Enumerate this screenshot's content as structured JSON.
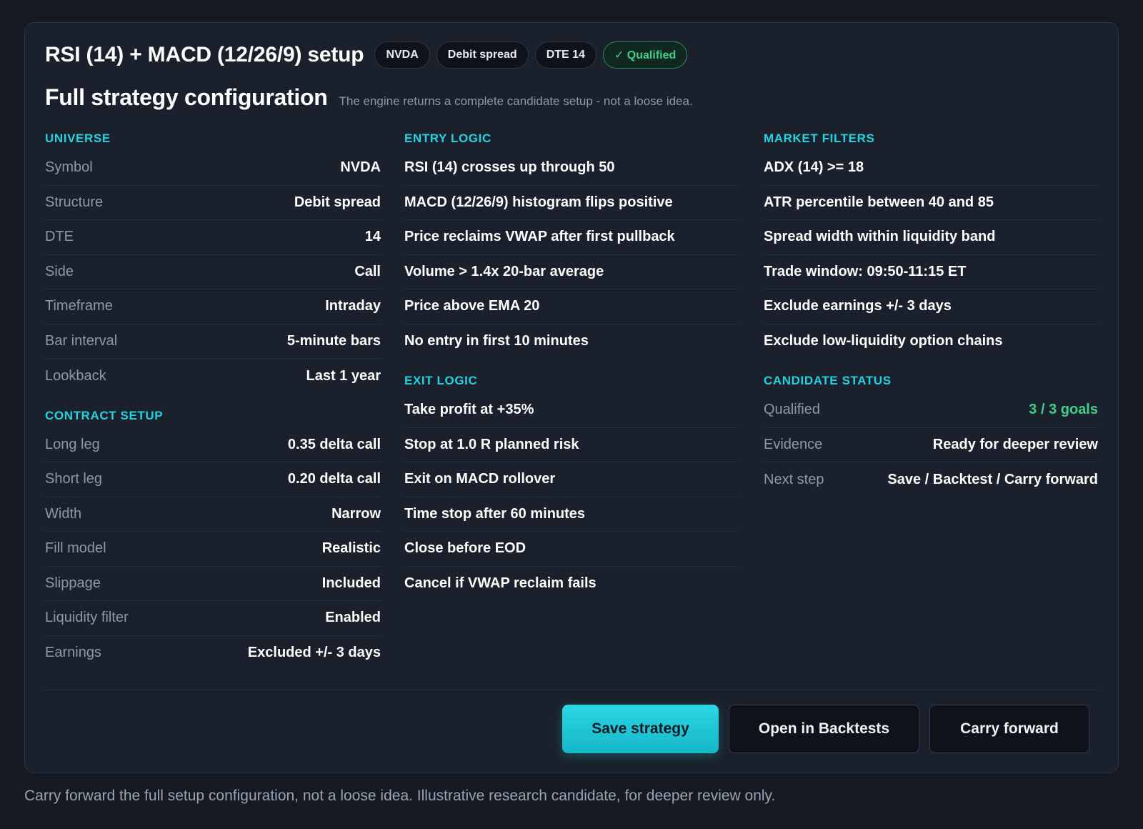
{
  "header": {
    "title": "RSI (14) + MACD (12/26/9) setup",
    "pills": [
      "NVDA",
      "Debit spread",
      "DTE 14"
    ],
    "status_pill": "✓ Qualified"
  },
  "section": {
    "title": "Full strategy configuration",
    "description": "The engine returns a complete candidate setup - not a loose idea."
  },
  "universe": {
    "label": "UNIVERSE",
    "rows": [
      {
        "k": "Symbol",
        "v": "NVDA"
      },
      {
        "k": "Structure",
        "v": "Debit spread"
      },
      {
        "k": "DTE",
        "v": "14"
      },
      {
        "k": "Side",
        "v": "Call"
      },
      {
        "k": "Timeframe",
        "v": "Intraday"
      },
      {
        "k": "Bar interval",
        "v": "5-minute bars"
      },
      {
        "k": "Lookback",
        "v": "Last 1 year"
      }
    ]
  },
  "contract": {
    "label": "CONTRACT SETUP",
    "rows": [
      {
        "k": "Long leg",
        "v": "0.35 delta call"
      },
      {
        "k": "Short leg",
        "v": "0.20 delta call"
      },
      {
        "k": "Width",
        "v": "Narrow"
      },
      {
        "k": "Fill model",
        "v": "Realistic"
      },
      {
        "k": "Slippage",
        "v": "Included"
      },
      {
        "k": "Liquidity filter",
        "v": "Enabled"
      },
      {
        "k": "Earnings",
        "v": "Excluded +/- 3 days"
      }
    ]
  },
  "entry": {
    "label": "ENTRY LOGIC",
    "items": [
      "RSI (14) crosses up through 50",
      "MACD (12/26/9) histogram flips positive",
      "Price reclaims VWAP after first pullback",
      "Volume > 1.4x 20-bar average",
      "Price above EMA 20",
      "No entry in first 10 minutes"
    ]
  },
  "exit": {
    "label": "EXIT LOGIC",
    "items": [
      "Take profit at +35%",
      "Stop at 1.0 R planned risk",
      "Exit on MACD rollover",
      "Time stop after 60 minutes",
      "Close before EOD",
      "Cancel if VWAP reclaim fails"
    ]
  },
  "filters": {
    "label": "MARKET FILTERS",
    "items": [
      "ADX (14) >= 18",
      "ATR percentile between 40 and 85",
      "Spread width within liquidity band",
      "Trade window: 09:50-11:15 ET",
      "Exclude earnings +/- 3 days",
      "Exclude low-liquidity option chains"
    ]
  },
  "status": {
    "label": "CANDIDATE STATUS",
    "rows": [
      {
        "k": "Qualified",
        "v": "3 / 3 goals"
      },
      {
        "k": "Evidence",
        "v": "Ready for deeper review"
      },
      {
        "k": "Next step",
        "v": "Save / Backtest / Carry forward"
      }
    ]
  },
  "actions": {
    "save": "Save strategy",
    "open": "Open in Backtests",
    "carry": "Carry forward"
  },
  "footnote": "Carry forward the full setup configuration, not a loose idea. Illustrative research candidate, for deeper review only.",
  "colors": {
    "accent": "#22d3e0",
    "success": "#3ed08a",
    "background": "#141922",
    "card": "#1a212c"
  }
}
